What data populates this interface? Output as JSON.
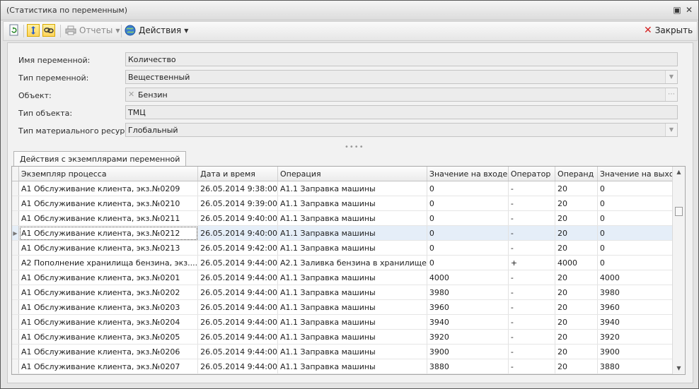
{
  "window": {
    "title": "(Статистика по переменным)",
    "btn_restore": "▣",
    "btn_close": "✕"
  },
  "toolbar": {
    "reports_label": "Отчеты",
    "actions_label": "Действия",
    "close_label": "Закрыть",
    "close_icon_glyph": "✕"
  },
  "form": {
    "variable_name": {
      "label": "Имя переменной:",
      "value": "Количество"
    },
    "variable_type": {
      "label": "Тип переменной:",
      "value": "Вещественный"
    },
    "object": {
      "label": "Объект:",
      "value": "Бензин"
    },
    "object_type": {
      "label": "Тип объекта:",
      "value": "ТМЦ"
    },
    "resource_type": {
      "label": "Тип материального ресурса:",
      "value": "Глобальный"
    }
  },
  "tab": {
    "label": "Действия с экземплярами переменной"
  },
  "grid": {
    "columns": [
      "Экземпляр процесса",
      "Дата и время",
      "Операция",
      "Значение на входе",
      "Оператор",
      "Операнд",
      "Значение на выходе"
    ],
    "selected_row": 3,
    "rows": [
      [
        "А1 Обслуживание клиента, экз.№0209",
        "26.05.2014 9:38:00",
        "А1.1 Заправка машины",
        "0",
        "-",
        "20",
        "0"
      ],
      [
        "А1 Обслуживание клиента, экз.№0210",
        "26.05.2014 9:39:00",
        "А1.1 Заправка машины",
        "0",
        "-",
        "20",
        "0"
      ],
      [
        "А1 Обслуживание клиента, экз.№0211",
        "26.05.2014 9:40:00",
        "А1.1 Заправка машины",
        "0",
        "-",
        "20",
        "0"
      ],
      [
        "А1 Обслуживание клиента, экз.№0212",
        "26.05.2014 9:40:00",
        "А1.1 Заправка машины",
        "0",
        "-",
        "20",
        "0"
      ],
      [
        "А1 Обслуживание клиента, экз.№0213",
        "26.05.2014 9:42:00",
        "А1.1 Заправка машины",
        "0",
        "-",
        "20",
        "0"
      ],
      [
        "А2 Пополнение хранилища бензина, экз....",
        "26.05.2014 9:44:00",
        "А2.1 Заливка бензина в хранилище",
        "0",
        "+",
        "4000",
        "0"
      ],
      [
        "А1 Обслуживание клиента, экз.№0201",
        "26.05.2014 9:44:00",
        "А1.1 Заправка машины",
        "4000",
        "-",
        "20",
        "4000"
      ],
      [
        "А1 Обслуживание клиента, экз.№0202",
        "26.05.2014 9:44:00",
        "А1.1 Заправка машины",
        "3980",
        "-",
        "20",
        "3980"
      ],
      [
        "А1 Обслуживание клиента, экз.№0203",
        "26.05.2014 9:44:00",
        "А1.1 Заправка машины",
        "3960",
        "-",
        "20",
        "3960"
      ],
      [
        "А1 Обслуживание клиента, экз.№0204",
        "26.05.2014 9:44:00",
        "А1.1 Заправка машины",
        "3940",
        "-",
        "20",
        "3940"
      ],
      [
        "А1 Обслуживание клиента, экз.№0205",
        "26.05.2014 9:44:00",
        "А1.1 Заправка машины",
        "3920",
        "-",
        "20",
        "3920"
      ],
      [
        "А1 Обслуживание клиента, экз.№0206",
        "26.05.2014 9:44:00",
        "А1.1 Заправка машины",
        "3900",
        "-",
        "20",
        "3900"
      ],
      [
        "А1 Обслуживание клиента, экз.№0207",
        "26.05.2014 9:44:00",
        "А1.1 Заправка машины",
        "3880",
        "-",
        "20",
        "3880"
      ]
    ]
  },
  "colors": {
    "selected_row": "#e5eef8",
    "active_toggle": "#ffd45a",
    "close_icon": "#d42020"
  },
  "icons": {
    "refresh": "refresh-icon",
    "expand": "expand-arrows-icon",
    "link": "link-icon",
    "print": "printer-icon",
    "globe": "globe-icon",
    "close": "close-icon"
  }
}
